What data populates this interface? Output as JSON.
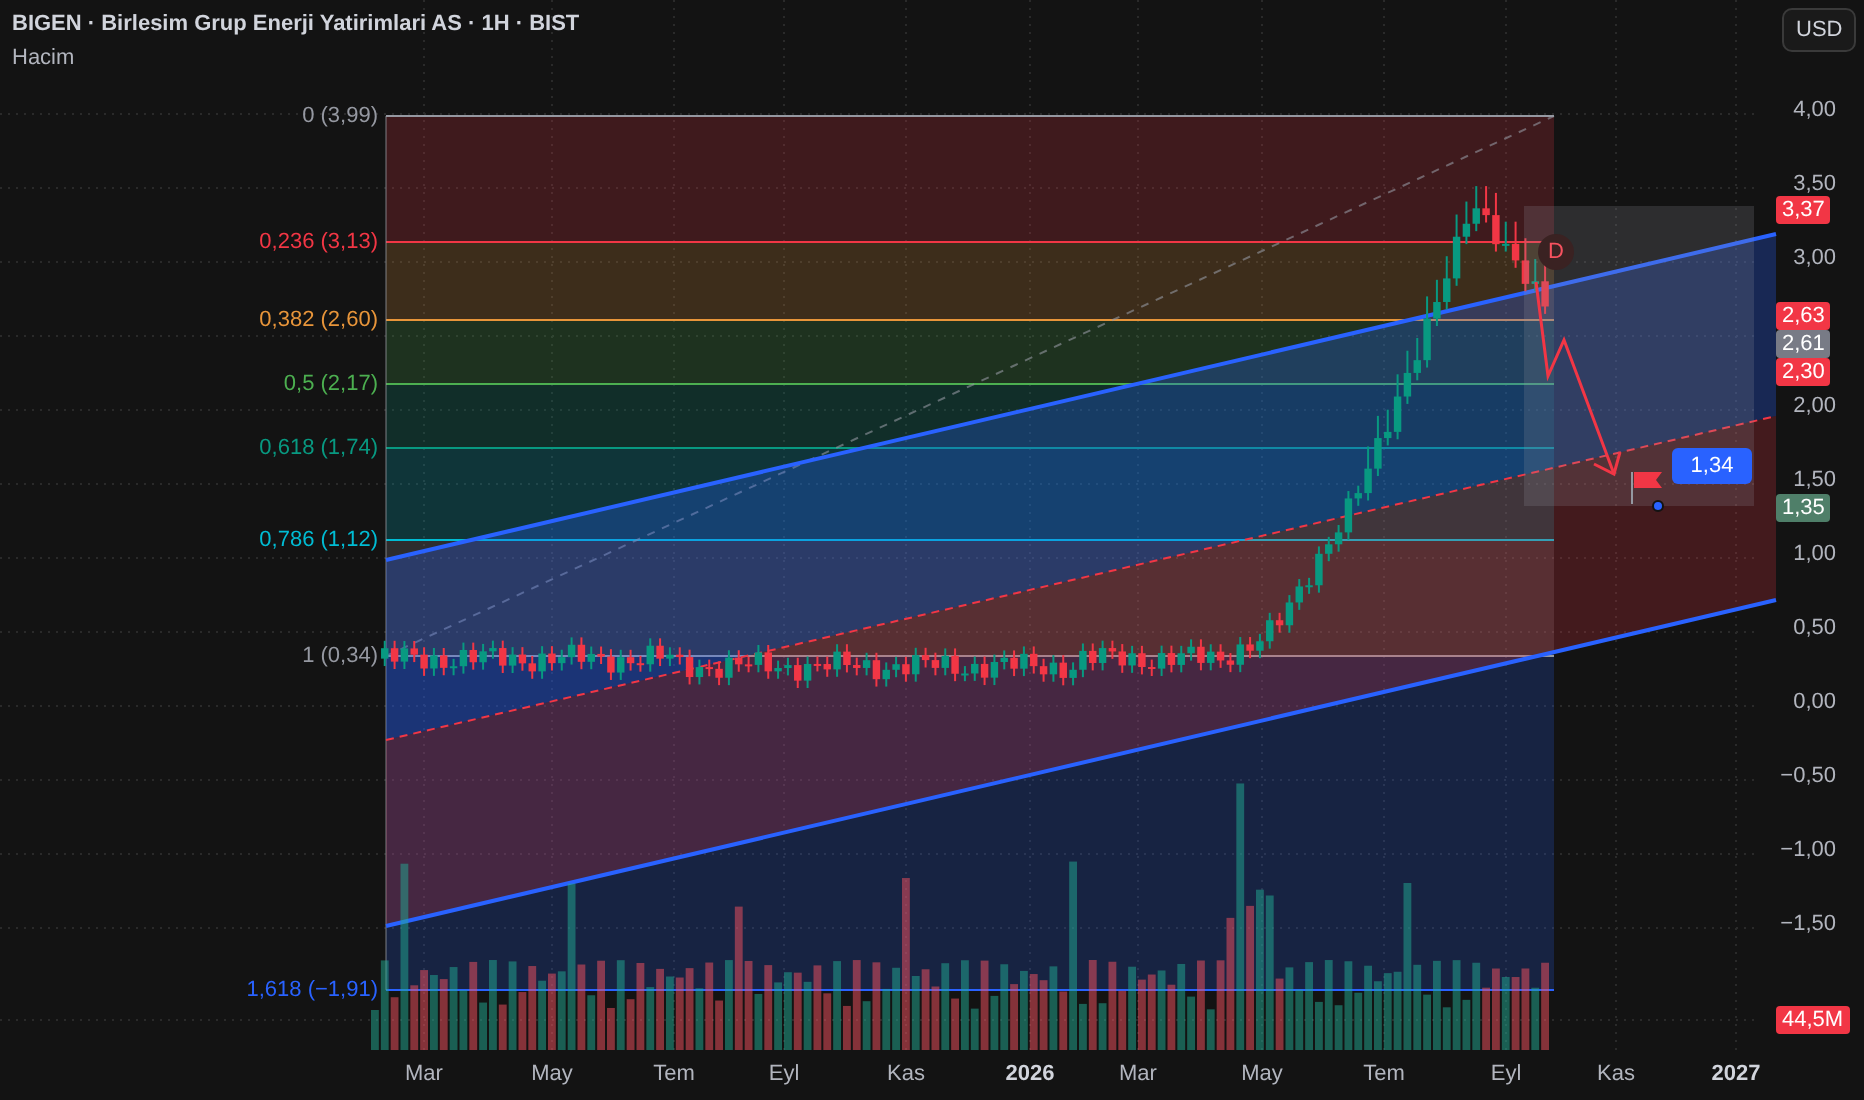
{
  "header": {
    "title": "BIGEN · Birlesim Grup Enerji Yatirimlari AS · 1H · BIST",
    "indicator": "Hacim"
  },
  "currency_button": "USD",
  "price_axis": {
    "ticks": [
      "4,00",
      "3,50",
      "3,00",
      "2,00",
      "1,50",
      "1,00",
      "0,50",
      "0,00",
      "−0,50",
      "−1,00",
      "−1,50"
    ]
  },
  "time_axis": {
    "labels": [
      {
        "text": "Mar",
        "bold": false
      },
      {
        "text": "May",
        "bold": false
      },
      {
        "text": "Tem",
        "bold": false
      },
      {
        "text": "Eyl",
        "bold": false
      },
      {
        "text": "Kas",
        "bold": false
      },
      {
        "text": "2026",
        "bold": true
      },
      {
        "text": "Mar",
        "bold": false
      },
      {
        "text": "May",
        "bold": false
      },
      {
        "text": "Tem",
        "bold": false
      },
      {
        "text": "Eyl",
        "bold": false
      },
      {
        "text": "Kas",
        "bold": false
      },
      {
        "text": "2027",
        "bold": true
      }
    ]
  },
  "fib_levels": [
    {
      "label": "0 (3,99)",
      "color": "#9598a1"
    },
    {
      "label": "0,236 (3,13)",
      "color": "#f23645"
    },
    {
      "label": "0,382 (2,60)",
      "color": "#e8953a"
    },
    {
      "label": "0,5 (2,17)",
      "color": "#4caf50"
    },
    {
      "label": "0,618 (1,74)",
      "color": "#089981"
    },
    {
      "label": "0,786 (1,12)",
      "color": "#00bcd4"
    },
    {
      "label": "1 (0,34)",
      "color": "#9598a1"
    },
    {
      "label": "1,618 (−1,91)",
      "color": "#2962ff"
    }
  ],
  "price_badges": [
    {
      "text": "3,37",
      "color": "#f23645"
    },
    {
      "text": "2,63",
      "color": "#f23645"
    },
    {
      "text": "2,61",
      "color": "#787b86"
    },
    {
      "text": "2,30",
      "color": "#f23645"
    },
    {
      "text": "1,35",
      "color": "#4f7f69"
    },
    {
      "text": "44,5M",
      "color": "#f23645"
    }
  ],
  "callout": "1,34",
  "marker": "D"
}
